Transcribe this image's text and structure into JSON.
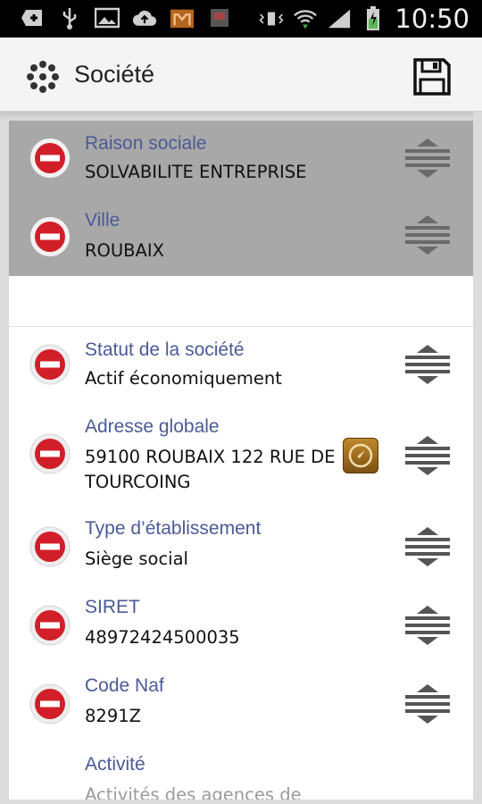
{
  "status_bar": {
    "time": "10:50",
    "icons": [
      "add-icon",
      "usb-icon",
      "image-icon",
      "cloud-upload-icon",
      "m-app-icon",
      "app-notif-icon",
      "vibrate-icon",
      "wifi-icon",
      "signal-icon",
      "battery-charging-icon"
    ]
  },
  "action_bar": {
    "title": "Société",
    "save_icon": "floppy-disk-icon"
  },
  "fields": [
    {
      "label": "Raison sociale",
      "value": "SOLVABILITE ENTREPRISE",
      "selected": true
    },
    {
      "label": "Ville",
      "value": "ROUBAIX",
      "selected": true
    },
    {
      "label": "Statut de la société",
      "value": "Actif économiquement",
      "selected": false
    },
    {
      "label": "Adresse globale",
      "value": "59100 ROUBAIX 122 RUE DE TOURCOING",
      "selected": false,
      "action_icon": "compass-icon"
    },
    {
      "label": "Type d’établissement",
      "value": "Siège social",
      "selected": false
    },
    {
      "label": "SIRET",
      "value": "48972424500035",
      "selected": false
    },
    {
      "label": "Code Naf",
      "value": "8291Z",
      "selected": false
    },
    {
      "label": "Activité",
      "value": "Activités des agences de",
      "selected": false
    }
  ],
  "colors": {
    "label": "#4b5a96",
    "selected_row": "#a8a8a8",
    "minus_red": "#d11f2a",
    "compass": "#a06a1c"
  }
}
